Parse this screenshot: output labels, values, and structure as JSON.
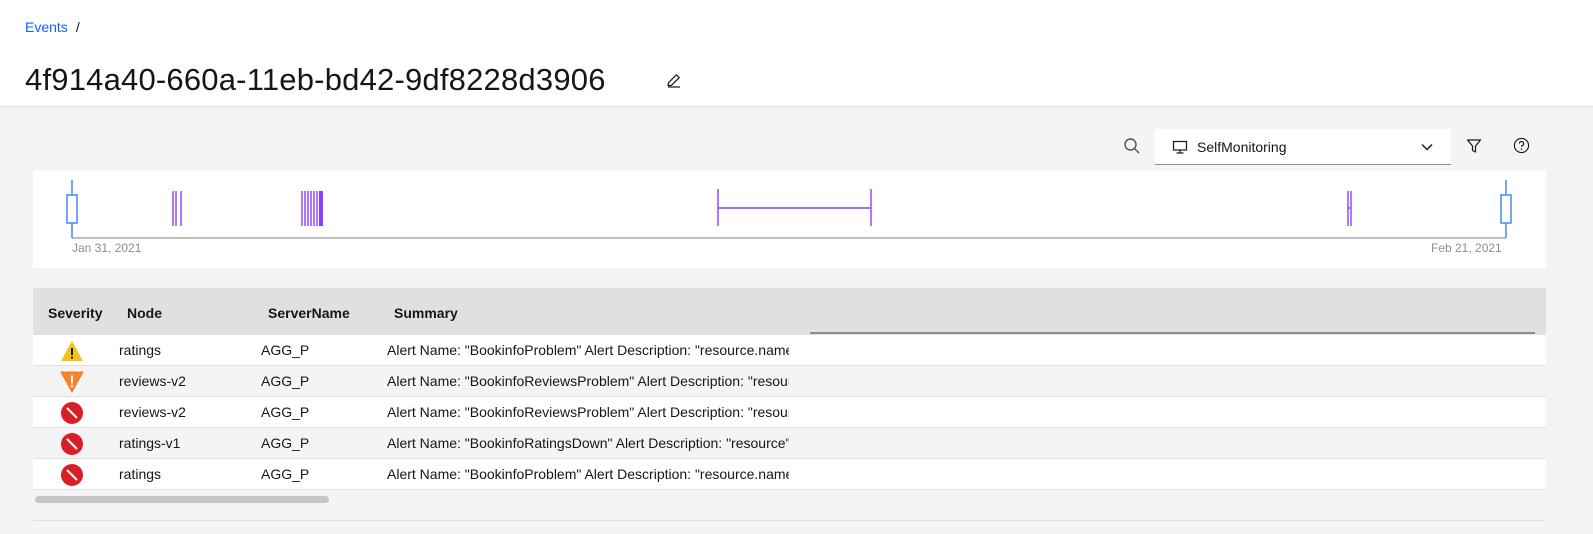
{
  "breadcrumb": {
    "root": "Events",
    "separator": "/"
  },
  "page": {
    "title": "4f914a40-660a-11eb-bd42-9df8228d3906",
    "edit_icon": "edit-icon"
  },
  "toolbar": {
    "search_icon": "search-icon",
    "dropdown": {
      "icon": "monitor-icon",
      "selected": "SelfMonitoring"
    },
    "filter_icon": "filter-icon",
    "help_icon": "help-icon"
  },
  "timeline": {
    "start_label": "Jan 31, 2021",
    "end_label": "Feb 21, 2021",
    "accent": "#8a3ffc",
    "handle_color": "#4589ff"
  },
  "table": {
    "columns": [
      "Severity",
      "Node",
      "ServerName",
      "Summary"
    ],
    "rows": [
      {
        "severity": "warning",
        "node": "ratings",
        "server": "AGG_P",
        "summary": "Alert Name: \"BookinfoProblem\" Alert Description: \"resource.name\""
      },
      {
        "severity": "minor",
        "node": "reviews-v2",
        "server": "AGG_P",
        "summary": "Alert Name: \"BookinfoReviewsProblem\" Alert Description: \"resource\""
      },
      {
        "severity": "critical",
        "node": "reviews-v2",
        "server": "AGG_P",
        "summary": "Alert Name: \"BookinfoReviewsProblem\" Alert Description: \"resource\""
      },
      {
        "severity": "critical",
        "node": "ratings-v1",
        "server": "AGG_P",
        "summary": "Alert Name: \"BookinfoRatingsDown\" Alert Description: \"resource\""
      },
      {
        "severity": "critical",
        "node": "ratings",
        "server": "AGG_P",
        "summary": "Alert Name: \"BookinfoProblem\" Alert Description: \"resource.name\""
      }
    ]
  },
  "colors": {
    "link": "#0f62fe",
    "warning": "#f1c21b",
    "minor": "#ff832b",
    "critical": "#da1e28"
  }
}
